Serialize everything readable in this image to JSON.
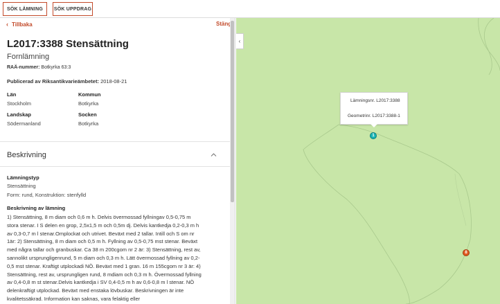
{
  "toolbar": {
    "search_lamning_label": "SÖK LÄMNING",
    "search_uppdrag_label": "SÖK UPPDRAG"
  },
  "panel": {
    "back_label": "Tillbaka",
    "close_label": "Stäng",
    "title": "L2017:3388 Stensättning",
    "subtitle": "Fornlämning",
    "raa_label": "RAÄ-nummer:",
    "raa_value": "Botkyrka 63:3",
    "published_label": "Publicerad av Riksantikvarieämbetet:",
    "published_value": "2018-08-21",
    "meta": {
      "lan_label": "Län",
      "lan_value": "Stockholm",
      "kommun_label": "Kommun",
      "kommun_value": "Botkyrka",
      "landskap_label": "Landskap",
      "landskap_value": "Södermanland",
      "socken_label": "Socken",
      "socken_value": "Botkyrka"
    },
    "section_title": "Beskrivning",
    "lamningstyp_label": "Lämningstyp",
    "lamningstyp_value": "Stensättning",
    "form_value": "Form: rund, Konstruktion: stenfylld",
    "beskrivning_label": "Beskrivning av lämning",
    "beskrivning_text": "1) Stensättning, 8 m diam och 0,6 m h. Delvis övermossad fyllningav 0,5-0,75 m stora stenar. I S delen en grop, 2,5x1,5 m och 0,5m dj. Delvis kantkedja 0,2-0,3 m h av 0,3-0,7 m l stenar.Omplockat och utrivet. Beväxt med 2 tallar. Intill och S om nr 1är: 2) Stensättning, 8 m diam och 0,5 m h. Fyllning av 0,5-0,75 mst stenar. Beväxt med några tallar och granbuskar. Ca 38 m 200cgom nr 2 är: 3) Stensättning, rest av, sannolikt ursprungligenrund, 5 m diam och 0,3 m h. Lätt övermossad fyllning av 0,2-0,5 mst stenar. Kraftigt utplockadi NÖ. Beväxt med 1 gran. 16 m 155cgom nr 3 är: 4) Stensättning, rest av, ursprungligen rund, 8 mdiam och 0,3 m h. Övermossad fyllning av 0,4-0,8 m st stenar.Delvis kantkedja i SV 0,4-0,5 m h av 0,6-0,8 m l stenar. NÖ delenkraftigt utplockad. Beväxt med enstaka lövbuskar. Beskrivningen är inte kvalitetssäkrad. Information kan saknas, vara felaktig eller"
  },
  "map": {
    "popup_line1": "Lämningsnr. L2017:3388",
    "popup_line2": "Geometrinr. L2017:3388-1",
    "marker_1_label": "1",
    "marker_8_label": "8",
    "background_color": "#c8e6a8",
    "marker_teal": "#19b3b3",
    "marker_orange": "#e05a20"
  },
  "colors": {
    "accent": "#c24a2a"
  }
}
